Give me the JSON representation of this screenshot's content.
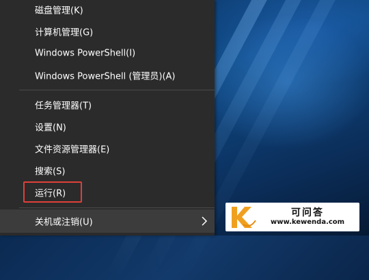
{
  "menu": {
    "items": [
      {
        "label": "磁盘管理(K)"
      },
      {
        "label": "计算机管理(G)"
      },
      {
        "label": "Windows PowerShell(I)"
      },
      {
        "label": "Windows PowerShell (管理员)(A)"
      },
      {
        "label": "任务管理器(T)"
      },
      {
        "label": "设置(N)"
      },
      {
        "label": "文件资源管理器(E)"
      },
      {
        "label": "搜索(S)"
      },
      {
        "label": "运行(R)"
      },
      {
        "label": "关机或注销(U)"
      }
    ],
    "submenu_icon": "chevron-right-icon"
  },
  "annotation": {
    "highlight_color": "#e0403a",
    "highlighted_item": "运行(R)"
  },
  "watermark": {
    "title": "可问答",
    "url": "www.kewenda.com",
    "logo_letter": "K",
    "logo_color": "#f0a020"
  },
  "colors": {
    "menu_bg": "#2b2b2b",
    "text": "#ffffff",
    "separator": "#4a4a4a"
  }
}
